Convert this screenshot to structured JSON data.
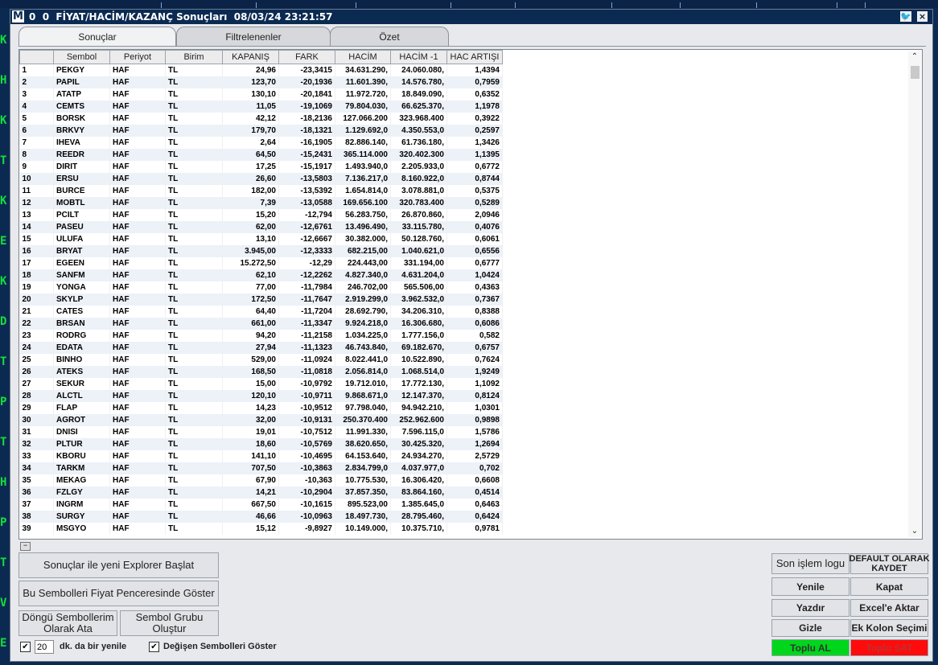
{
  "app": {
    "logo": "M",
    "title": "0  0  FİYAT/HACİM/KAZANÇ Sonuçları  08/03/24 23:21:57"
  },
  "side_letters": [
    "K",
    "H",
    "K",
    "T",
    "K",
    "E",
    "K",
    "D",
    "T",
    "P",
    "T",
    "H",
    "P",
    "T",
    "V",
    "E"
  ],
  "tabs": [
    {
      "label": "Sonuçlar",
      "active": true
    },
    {
      "label": "Filtrelenenler",
      "active": false
    },
    {
      "label": "Özet",
      "active": false
    }
  ],
  "table": {
    "columns": [
      "",
      "Sembol",
      "Periyot",
      "Birim",
      "KAPANIŞ",
      "FARK",
      "HACİM",
      "HACİM -1",
      "HAC ARTIŞI"
    ],
    "rows": [
      [
        "1",
        "PEKGY",
        "HAF",
        "TL",
        "24,96",
        "-23,3415",
        "34.631.290,",
        "24.060.080,",
        "1,4394"
      ],
      [
        "2",
        "PAPIL",
        "HAF",
        "TL",
        "123,70",
        "-20,1936",
        "11.601.390,",
        "14.576.780,",
        "0,7959"
      ],
      [
        "3",
        "ATATP",
        "HAF",
        "TL",
        "130,10",
        "-20,1841",
        "11.972.720,",
        "18.849.090,",
        "0,6352"
      ],
      [
        "4",
        "CEMTS",
        "HAF",
        "TL",
        "11,05",
        "-19,1069",
        "79.804.030,",
        "66.625.370,",
        "1,1978"
      ],
      [
        "5",
        "BORSK",
        "HAF",
        "TL",
        "42,12",
        "-18,2136",
        "127.066.200",
        "323.968.400",
        "0,3922"
      ],
      [
        "6",
        "BRKVY",
        "HAF",
        "TL",
        "179,70",
        "-18,1321",
        "1.129.692,0",
        "4.350.553,0",
        "0,2597"
      ],
      [
        "7",
        "IHEVA",
        "HAF",
        "TL",
        "2,64",
        "-16,1905",
        "82.886.140,",
        "61.736.180,",
        "1,3426"
      ],
      [
        "8",
        "REEDR",
        "HAF",
        "TL",
        "64,50",
        "-15,2431",
        "365.114.000",
        "320.402.300",
        "1,1395"
      ],
      [
        "9",
        "DIRIT",
        "HAF",
        "TL",
        "17,25",
        "-15,1917",
        "1.493.940,0",
        "2.205.933,0",
        "0,6772"
      ],
      [
        "10",
        "ERSU",
        "HAF",
        "TL",
        "26,60",
        "-13,5803",
        "7.136.217,0",
        "8.160.922,0",
        "0,8744"
      ],
      [
        "11",
        "BURCE",
        "HAF",
        "TL",
        "182,00",
        "-13,5392",
        "1.654.814,0",
        "3.078.881,0",
        "0,5375"
      ],
      [
        "12",
        "MOBTL",
        "HAF",
        "TL",
        "7,39",
        "-13,0588",
        "169.656.100",
        "320.783.400",
        "0,5289"
      ],
      [
        "13",
        "PCILT",
        "HAF",
        "TL",
        "15,20",
        "-12,794",
        "56.283.750,",
        "26.870.860,",
        "2,0946"
      ],
      [
        "14",
        "PASEU",
        "HAF",
        "TL",
        "62,00",
        "-12,6761",
        "13.496.490,",
        "33.115.780,",
        "0,4076"
      ],
      [
        "15",
        "ULUFA",
        "HAF",
        "TL",
        "13,10",
        "-12,6667",
        "30.382.000,",
        "50.128.760,",
        "0,6061"
      ],
      [
        "16",
        "BRYAT",
        "HAF",
        "TL",
        "3.945,00",
        "-12,3333",
        "682.215,00",
        "1.040.621,0",
        "0,6556"
      ],
      [
        "17",
        "EGEEN",
        "HAF",
        "TL",
        "15.272,50",
        "-12,29",
        "224.443,00",
        "331.194,00",
        "0,6777"
      ],
      [
        "18",
        "SANFM",
        "HAF",
        "TL",
        "62,10",
        "-12,2262",
        "4.827.340,0",
        "4.631.204,0",
        "1,0424"
      ],
      [
        "19",
        "YONGA",
        "HAF",
        "TL",
        "77,00",
        "-11,7984",
        "246.702,00",
        "565.506,00",
        "0,4363"
      ],
      [
        "20",
        "SKYLP",
        "HAF",
        "TL",
        "172,50",
        "-11,7647",
        "2.919.299,0",
        "3.962.532,0",
        "0,7367"
      ],
      [
        "21",
        "CATES",
        "HAF",
        "TL",
        "64,40",
        "-11,7204",
        "28.692.790,",
        "34.206.310,",
        "0,8388"
      ],
      [
        "22",
        "BRSAN",
        "HAF",
        "TL",
        "661,00",
        "-11,3347",
        "9.924.218,0",
        "16.306.680,",
        "0,6086"
      ],
      [
        "23",
        "RODRG",
        "HAF",
        "TL",
        "94,20",
        "-11,2158",
        "1.034.225,0",
        "1.777.156,0",
        "0,582"
      ],
      [
        "24",
        "EDATA",
        "HAF",
        "TL",
        "27,94",
        "-11,1323",
        "46.743.840,",
        "69.182.670,",
        "0,6757"
      ],
      [
        "25",
        "BINHO",
        "HAF",
        "TL",
        "529,00",
        "-11,0924",
        "8.022.441,0",
        "10.522.890,",
        "0,7624"
      ],
      [
        "26",
        "ATEKS",
        "HAF",
        "TL",
        "168,50",
        "-11,0818",
        "2.056.814,0",
        "1.068.514,0",
        "1,9249"
      ],
      [
        "27",
        "SEKUR",
        "HAF",
        "TL",
        "15,00",
        "-10,9792",
        "19.712.010,",
        "17.772.130,",
        "1,1092"
      ],
      [
        "28",
        "ALCTL",
        "HAF",
        "TL",
        "120,10",
        "-10,9711",
        "9.868.671,0",
        "12.147.370,",
        "0,8124"
      ],
      [
        "29",
        "FLAP",
        "HAF",
        "TL",
        "14,23",
        "-10,9512",
        "97.798.040,",
        "94.942.210,",
        "1,0301"
      ],
      [
        "30",
        "AGROT",
        "HAF",
        "TL",
        "32,00",
        "-10,9131",
        "250.370.400",
        "252.962.600",
        "0,9898"
      ],
      [
        "31",
        "DNISI",
        "HAF",
        "TL",
        "19,01",
        "-10,7512",
        "11.991.330,",
        "7.596.115,0",
        "1,5786"
      ],
      [
        "32",
        "PLTUR",
        "HAF",
        "TL",
        "18,60",
        "-10,5769",
        "38.620.650,",
        "30.425.320,",
        "1,2694"
      ],
      [
        "33",
        "KBORU",
        "HAF",
        "TL",
        "141,10",
        "-10,4695",
        "64.153.640,",
        "24.934.270,",
        "2,5729"
      ],
      [
        "34",
        "TARKM",
        "HAF",
        "TL",
        "707,50",
        "-10,3863",
        "2.834.799,0",
        "4.037.977,0",
        "0,702"
      ],
      [
        "35",
        "MEKAG",
        "HAF",
        "TL",
        "67,90",
        "-10,363",
        "10.775.530,",
        "16.306.420,",
        "0,6608"
      ],
      [
        "36",
        "FZLGY",
        "HAF",
        "TL",
        "14,21",
        "-10,2904",
        "37.857.350,",
        "83.864.160,",
        "0,4514"
      ],
      [
        "37",
        "INGRM",
        "HAF",
        "TL",
        "667,50",
        "-10,1615",
        "895.523,00",
        "1.385.645,0",
        "0,6463"
      ],
      [
        "38",
        "SURGY",
        "HAF",
        "TL",
        "46,66",
        "-10,0963",
        "18.497.730,",
        "28.795.460,",
        "0,6424"
      ],
      [
        "39",
        "MSGYO",
        "HAF",
        "TL",
        "15,12",
        "-9,8927",
        "10.149.000,",
        "10.375.710,",
        "0,9781"
      ]
    ]
  },
  "buttons": {
    "start_explorer": "Sonuçlar ile yeni Explorer Başlat",
    "show_in_price": "Bu Sembolleri Fiyat Penceresinde Göster",
    "loop_assign": "Döngü Sembollerim\nOlarak Ata",
    "create_group": "Sembol Grubu\nOluştur",
    "last_log": "Son işlem logu",
    "save_default": "DEFAULT OLARAK\nKAYDET",
    "refresh": "Yenile",
    "close": "Kapat",
    "print": "Yazdır",
    "export_excel": "Excel'e Aktar",
    "hide": "Gizle",
    "extra_columns": "Ek Kolon Seçimi",
    "bulk_buy": "Toplu AL",
    "bulk_sell": "Toplu SAT"
  },
  "options": {
    "refresh_minutes": "20",
    "refresh_label": "dk. da bir yenile",
    "refresh_checked": true,
    "show_changed_label": "Değişen Sembolleri Göster",
    "show_changed_checked": true
  }
}
